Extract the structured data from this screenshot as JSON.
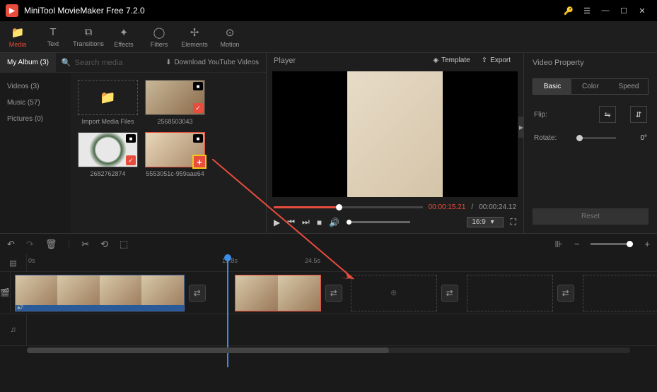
{
  "app": {
    "title": "MiniTool MovieMaker Free 7.2.0"
  },
  "toolbar": {
    "media": "Media",
    "text": "Text",
    "transitions": "Transitions",
    "effects": "Effects",
    "filters": "Filters",
    "elements": "Elements",
    "motion": "Motion"
  },
  "media": {
    "album_tab": "My Album (3)",
    "search_placeholder": "Search media",
    "download_link": "Download YouTube Videos",
    "sidebar": {
      "videos": "Videos (3)",
      "music": "Music (57)",
      "pictures": "Pictures (0)"
    },
    "items": {
      "import": "Import Media Files",
      "i1": "2568503043",
      "i2": "2682762874",
      "i3": "5553051c-959aae64"
    }
  },
  "player": {
    "title": "Player",
    "template": "Template",
    "export": "Export",
    "time_current": "00:00:15.21",
    "time_sep": " / ",
    "time_total": "00:00:24.12",
    "speed": "16:9"
  },
  "props": {
    "title": "Video Property",
    "tabs": {
      "basic": "Basic",
      "color": "Color",
      "speed": "Speed"
    },
    "flip": "Flip:",
    "rotate": "Rotate:",
    "rotate_val": "0°",
    "reset": "Reset"
  },
  "timeline": {
    "marks": {
      "m0": "0s",
      "m1": "15.8s",
      "m2": "24.5s"
    }
  }
}
